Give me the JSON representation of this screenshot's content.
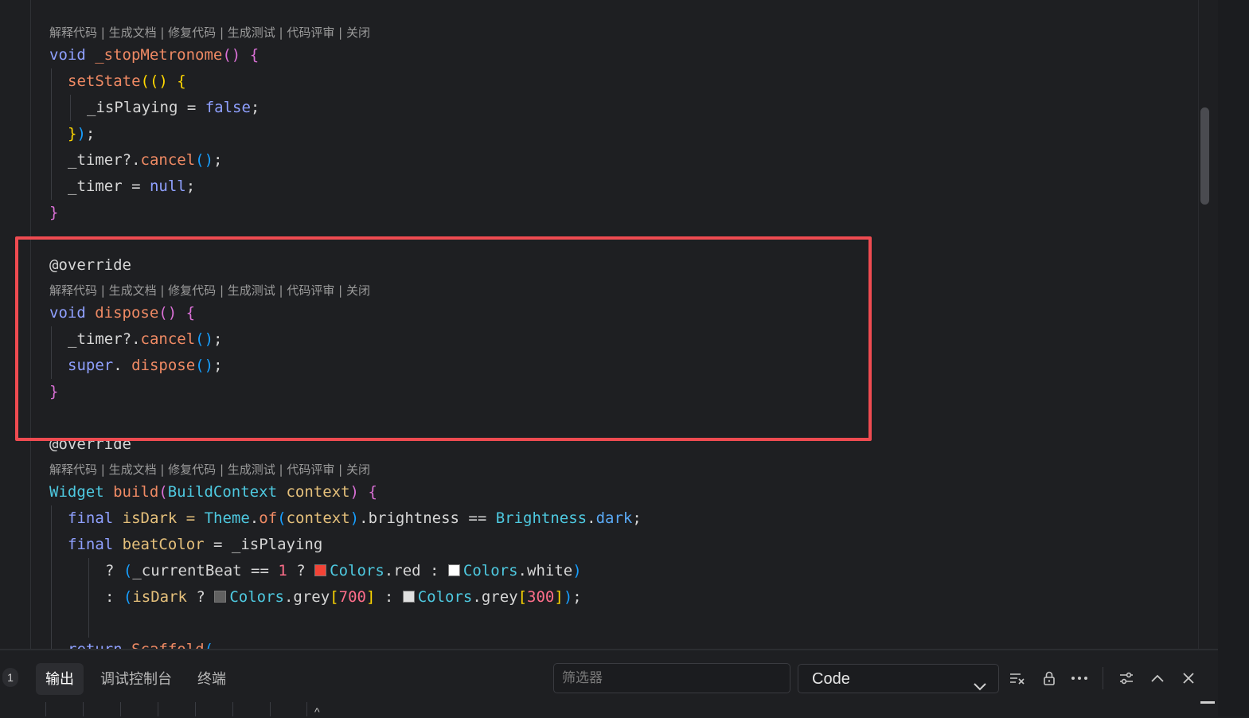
{
  "codelens": {
    "text": "解释代码 | 生成文档 | 修复代码 | 生成测试 | 代码评审 | 关闭"
  },
  "code": {
    "l_void1": "void",
    "l_stop_name": " _stopMetronome",
    "l_setState": "setState",
    "l_isPlaying": "_isPlaying = ",
    "l_false": "false",
    "l_timer": "_timer?.",
    "l_cancel": "cancel",
    "l_timer_eq": "_timer = ",
    "l_null": "null",
    "l_override": "@override",
    "l_void2": "void",
    "l_dispose": " dispose",
    "l_super": "super",
    "l_widget": "Widget",
    "l_build": " build",
    "l_buildcontext": "BuildContext",
    "l_context_param": " context",
    "l_final": "final",
    "l_isDark_decl": " isDark = ",
    "l_theme": "Theme",
    "l_of": "of",
    "l_context_arg": "context",
    "l_brightness": ".brightness == ",
    "l_brightness_type": "Brightness",
    "l_dark": "dark",
    "l_beatColor": " beatColor",
    "l_beatColor_rest": " = _isPlaying",
    "l_q1": "? ",
    "l_currentBeat": "_currentBeat == ",
    "l_one": "1",
    "l_q2": " ? ",
    "l_colors": "Colors",
    "l_red": "red",
    "l_colon": " : ",
    "l_white": "white",
    "l_c1": ": ",
    "l_isDark_expr": "isDark",
    "l_grey": "grey",
    "l_700": "700",
    "l_300": "300",
    "l_return": "return",
    "l_scaffold": " Scaffold"
  },
  "swatches": {
    "red": "#f44336",
    "white": "#ffffff",
    "grey700": "#616161",
    "grey300": "#e0e0e0"
  },
  "panel": {
    "badge": "1",
    "tabs": [
      "输出",
      "调试控制台",
      "终端"
    ],
    "filter_placeholder": "筛选器",
    "select_value": "Code"
  },
  "colors": {
    "highlight_border": "#ef4b51",
    "editor_bg": "#1e1f22"
  }
}
